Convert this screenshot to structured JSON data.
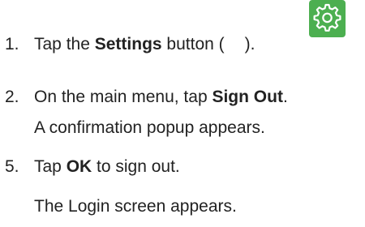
{
  "steps": [
    {
      "number": "1.",
      "parts": {
        "a": "Tap the ",
        "b": "Settings",
        "c": " button (",
        "d": ")."
      },
      "icon": "settings-gear-icon"
    },
    {
      "number": "2.",
      "parts": {
        "a": "On the main menu, tap ",
        "b": "Sign Out",
        "c": "."
      },
      "note": "A confirmation popup appears."
    },
    {
      "number": "5.",
      "parts": {
        "a": "Tap ",
        "b": "OK",
        "c": " to sign out."
      },
      "note": "The Login screen appears."
    }
  ],
  "colors": {
    "icon_bg": "#4CAF50",
    "icon_fg": "#ffffff",
    "text": "#222222"
  }
}
